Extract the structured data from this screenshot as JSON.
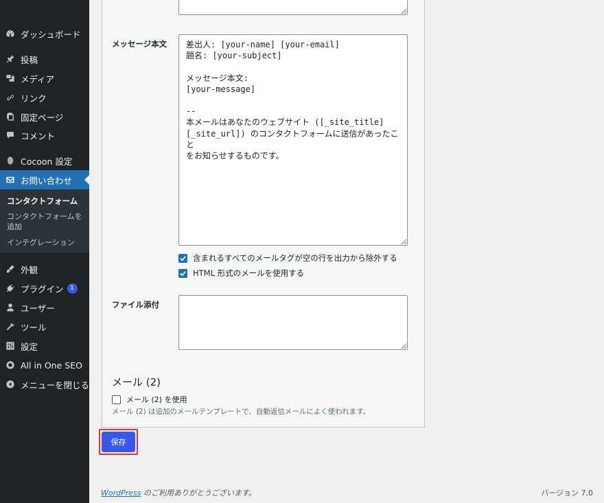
{
  "sidebar": {
    "items": [
      {
        "label": "ダッシュボード",
        "icon": "dashboard-icon"
      },
      {
        "label": "投稿",
        "icon": "pin-icon"
      },
      {
        "label": "メディア",
        "icon": "media-icon"
      },
      {
        "label": "リンク",
        "icon": "link-icon"
      },
      {
        "label": "固定ページ",
        "icon": "pages-icon"
      },
      {
        "label": "コメント",
        "icon": "comment-icon"
      },
      {
        "label": "Cocoon 設定",
        "icon": "cocoon-icon"
      },
      {
        "label": "お問い合わせ",
        "icon": "mail-icon"
      },
      {
        "label": "外観",
        "icon": "brush-icon"
      },
      {
        "label": "プラグイン",
        "icon": "plugin-icon",
        "badge": "1"
      },
      {
        "label": "ユーザー",
        "icon": "user-icon"
      },
      {
        "label": "ツール",
        "icon": "wrench-icon"
      },
      {
        "label": "設定",
        "icon": "settings-icon"
      },
      {
        "label": "All in One SEO",
        "icon": "aioseo-icon"
      },
      {
        "label": "メニューを閉じる",
        "icon": "collapse-icon"
      }
    ],
    "submenu": [
      {
        "label": "コンタクトフォーム"
      },
      {
        "label": "コンタクトフォームを追加"
      },
      {
        "label": "インテグレーション"
      }
    ]
  },
  "form": {
    "message_body_label": "メッセージ本文",
    "message_body_value": "差出人: [your-name] [your-email]\n題名: [your-subject]\n\nメッセージ本文:\n[your-message]\n\n--\n本メールはあなたのウェブサイト ([_site_title]\n[_site_url]) のコンタクトフォームに送信があったこと\nをお知らせするものです。",
    "exclude_blank_label": "含まれるすべてのメールタグが空の行を出力から除外する",
    "exclude_blank_checked": true,
    "html_mail_label": "HTML 形式のメールを使用する",
    "html_mail_checked": true,
    "attachments_label": "ファイル添付",
    "attachments_value": "",
    "mail2_title": "メール (2)",
    "mail2_checkbox_label": "メール (2) を使用",
    "mail2_checked": false,
    "mail2_description": "メール (2) は追加のメールテンプレートで、自動返信メールによく使われます。"
  },
  "save_label": "保存",
  "footer": {
    "link_text": "WordPress",
    "thanks_text": " のご利用ありがとうございます。",
    "version": "バージョン 7.0"
  },
  "colors": {
    "sidebar_bg": "#1d2327",
    "active_bg": "#2271b1",
    "primary_button": "#3858e9",
    "highlight_border": "#d63638"
  }
}
